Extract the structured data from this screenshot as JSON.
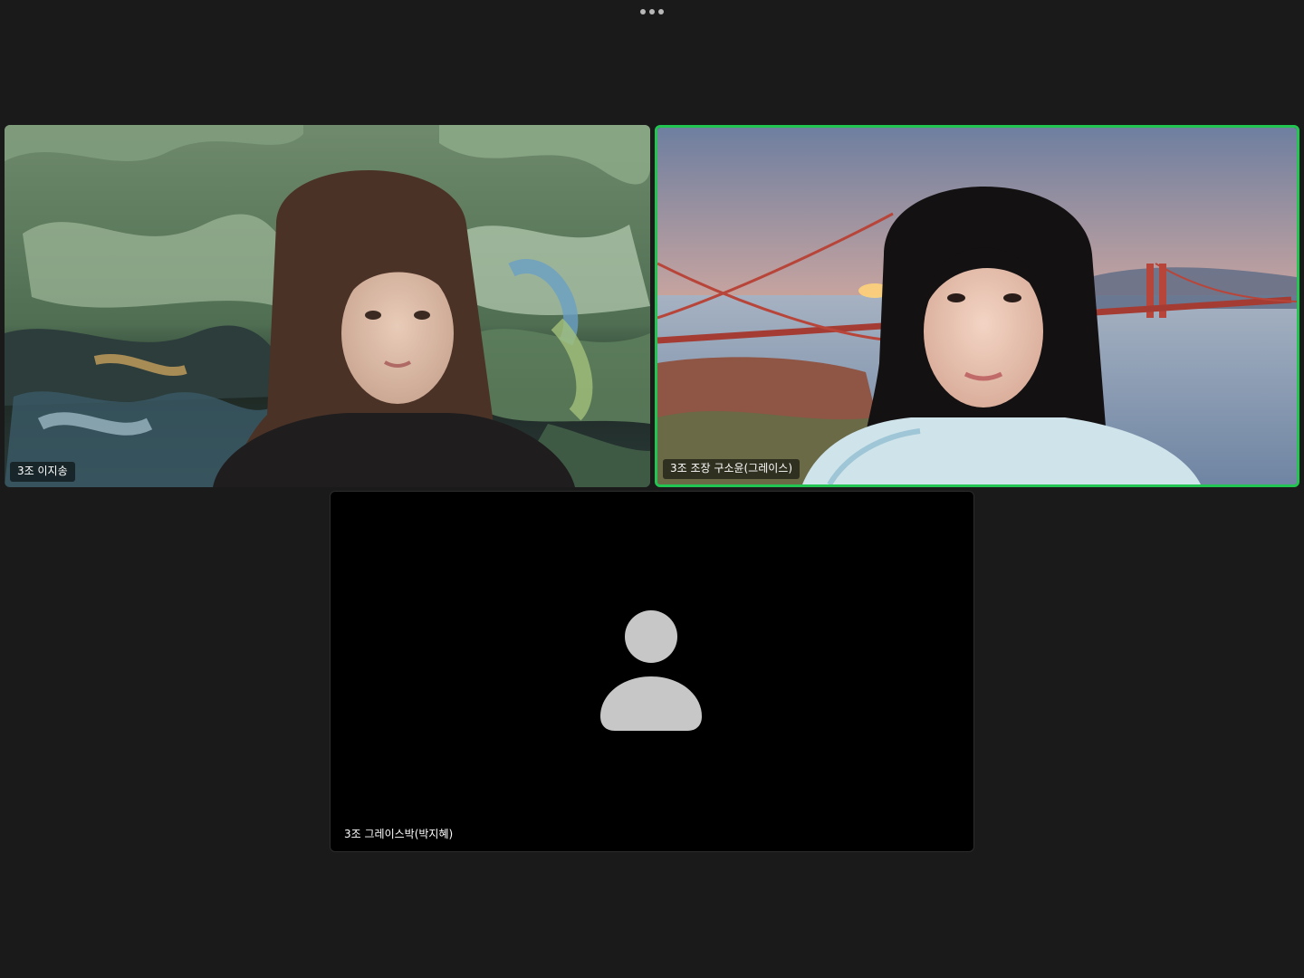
{
  "top_bar": {
    "more_icon": "more-horizontal-icon"
  },
  "participants": [
    {
      "name": "3조 이지송",
      "video": "on",
      "background": "green oil-painting virtual background",
      "active_speaker": false
    },
    {
      "name": "3조 조장 구소윤(그레이스)",
      "video": "on",
      "background": "bridge at sunset virtual background",
      "active_speaker": true
    },
    {
      "name": "3조 그레이스박(박지혜)",
      "video": "off",
      "avatar_icon": "person-silhouette-icon",
      "active_speaker": false
    }
  ],
  "colors": {
    "window_background": "#1a1a1a",
    "active_speaker_border": "#23c552",
    "avatar_fill": "#c8c7c8",
    "video_off_background": "#000000"
  }
}
